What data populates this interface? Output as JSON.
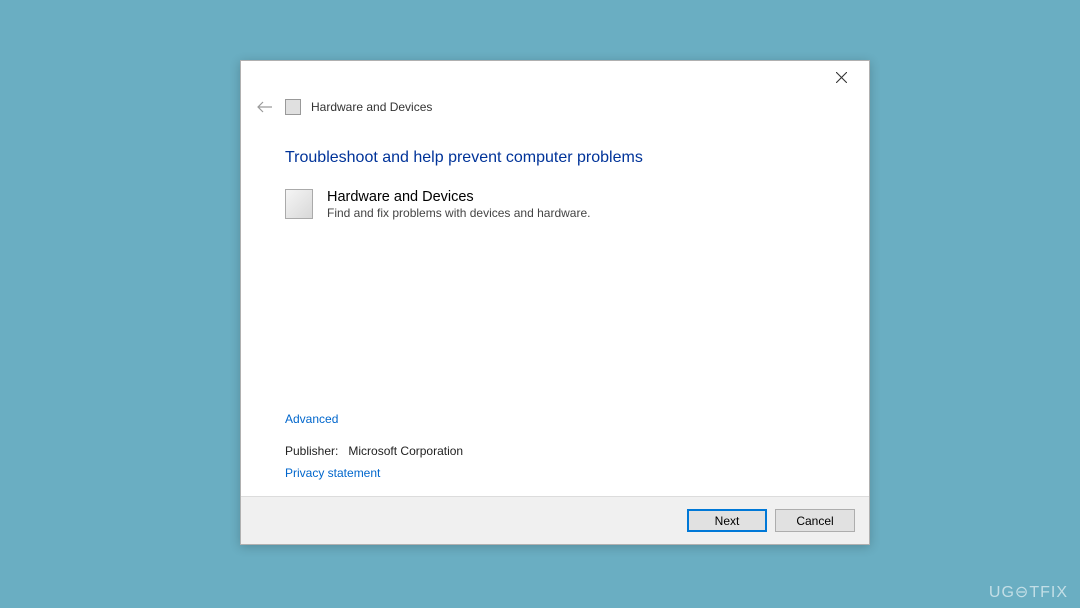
{
  "dialog": {
    "header_title": "Hardware and Devices",
    "main_heading": "Troubleshoot and help prevent computer problems",
    "troubleshooter": {
      "title": "Hardware and Devices",
      "description": "Find and fix problems with devices and hardware."
    },
    "advanced_label": "Advanced",
    "publisher_label": "Publisher:",
    "publisher_value": "Microsoft Corporation",
    "privacy_label": "Privacy statement",
    "buttons": {
      "next": "Next",
      "cancel": "Cancel"
    }
  },
  "watermark": "UG⊖TFIX"
}
